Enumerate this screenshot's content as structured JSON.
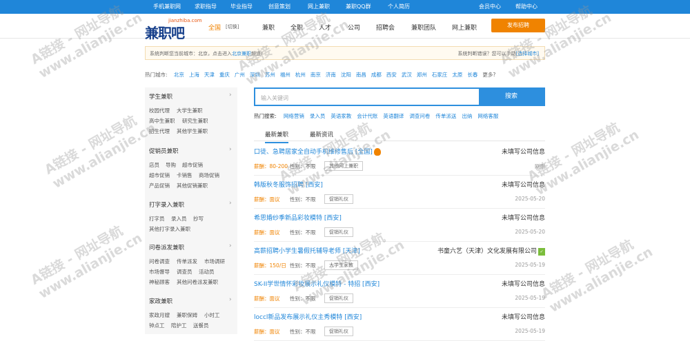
{
  "topbar": {
    "left_links": [
      "手机兼职网",
      "求职指导",
      "毕业指导",
      "创意策划",
      "网上兼职",
      "兼职QQ群",
      "个人简历"
    ],
    "right_links": [
      "会员中心",
      "帮助中心"
    ]
  },
  "header": {
    "logo_domain": "jianzhiba.com",
    "logo_name": "兼职吧",
    "city": "全国",
    "city_switch": "[切换]",
    "nav": [
      "兼职",
      "全职",
      "人才",
      "公司",
      "招聘会",
      "兼职团队",
      "网上兼职"
    ],
    "post_button": "发布招聘"
  },
  "notice": {
    "left_prefix": "系统判断您当前城市：北京，点击进入",
    "left_link": "北京兼职",
    "left_suffix": "频道!",
    "right_text": "系统判断错误？您可以手动",
    "right_link": "[选择城市]"
  },
  "hot_cities": {
    "label": "热门城市:",
    "cities": [
      "北京",
      "上海",
      "天津",
      "重庆",
      "广州",
      "深圳",
      "苏州",
      "福州",
      "杭州",
      "南京",
      "济南",
      "沈阳",
      "南昌",
      "成都",
      "西安",
      "武汉",
      "郑州",
      "石家庄",
      "太原",
      "长春"
    ],
    "more": "更多?"
  },
  "sidebar": {
    "categories": [
      {
        "title": "学生兼职",
        "items": [
          [
            "校园代理",
            "大学生兼职"
          ],
          [
            "高中生兼职",
            "研究生兼职"
          ],
          [
            "招生代理",
            "其他学生兼职"
          ]
        ]
      },
      {
        "title": "促销员兼职",
        "items": [
          [
            "店员",
            "导购",
            "超市促销"
          ],
          [
            "超市促销",
            "卡销售",
            "商场促销"
          ],
          [
            "产品促销",
            "其他促销兼职"
          ]
        ]
      },
      {
        "title": "打字录入兼职",
        "items": [
          [
            "打字员",
            "录入员",
            "抄写"
          ],
          [
            "其他打字录入兼职"
          ]
        ]
      },
      {
        "title": "问卷派发兼职",
        "items": [
          [
            "问卷调查",
            "传单派发",
            "市场调研"
          ],
          [
            "市场督导",
            "调查员",
            "活动员"
          ],
          [
            "神秘顾客",
            "其他问卷派发兼职"
          ]
        ]
      },
      {
        "title": "家政兼职",
        "items": [
          [
            "家政月嫂",
            "兼职保姆",
            "小时工"
          ],
          [
            "钟点工",
            "陪护工",
            "送餐员"
          ]
        ]
      }
    ]
  },
  "search": {
    "placeholder": "输入关键词",
    "button": "搜索"
  },
  "hot_search": {
    "label": "热门搜索:",
    "terms": [
      "网络营销",
      "录入员",
      "英语家教",
      "会计代账",
      "英语翻译",
      "调查问卷",
      "传单派送",
      "出纳",
      "网络客服"
    ]
  },
  "tabs": [
    "最新兼职",
    "最新资讯"
  ],
  "jobs": [
    {
      "title": "口徒、急聘居家全自动手机维修售后 [全国]",
      "company": "未填写公司信息",
      "salary": "薪酬：80-200",
      "gender": "性别：不限",
      "tag": "其他网上兼职",
      "date": "刚刚",
      "badge": "hot"
    },
    {
      "title": "韩版秋冬服饰招聘 [西安]",
      "company": "未填写公司信息",
      "salary": "薪酬：面议",
      "gender": "性别：不限",
      "tag": "促销礼仪",
      "date": "2025-05-20",
      "badge": ""
    },
    {
      "title": "希思婚纱季新品彩妆模特 [西安]",
      "company": "未填写公司信息",
      "salary": "薪酬：面议",
      "gender": "性别：不限",
      "tag": "促销礼仪",
      "date": "2025-05-20",
      "badge": ""
    },
    {
      "title": "高薪招聘小学生暑假托辅导老师 [天津]",
      "company": "书童六艺（天津）文化发展有限公司",
      "salary": "薪酬：150/日",
      "gender": "性别：不限",
      "tag": "大学生家教",
      "date": "2025-05-19",
      "badge": "green"
    },
    {
      "title": "SK-II学世情怀彩妆展示礼仪模特 - 特招 [西安]",
      "company": "未填写公司信息",
      "salary": "薪酬：面议",
      "gender": "性别：不限",
      "tag": "促销礼仪",
      "date": "2025-05-19",
      "badge": ""
    },
    {
      "title": "loccl新品发布展示礼仪主秀模特 [西安]",
      "company": "未填写公司信息",
      "salary": "薪酬：面议",
      "gender": "性别：不限",
      "tag": "促销礼仪",
      "date": "2025-05-19",
      "badge": ""
    }
  ],
  "watermark": {
    "line1": "A链接 - 网址导航",
    "line2": "www.alianjie.cn"
  }
}
